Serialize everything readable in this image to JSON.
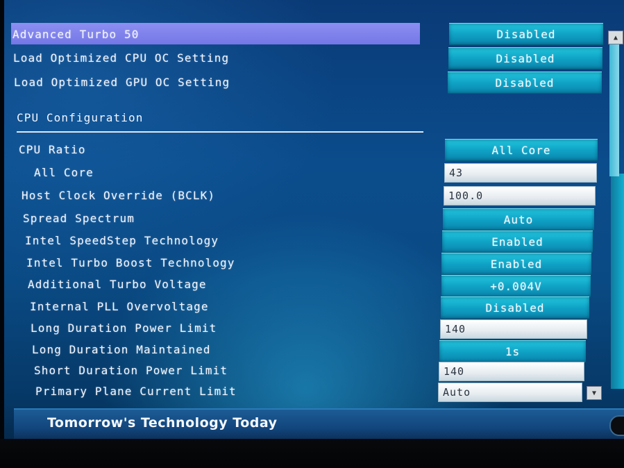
{
  "settings_top": [
    {
      "label": "Advanced Turbo 50",
      "value": "Disabled",
      "selected": true
    },
    {
      "label": "Load Optimized CPU OC Setting",
      "value": "Disabled"
    },
    {
      "label": "Load Optimized GPU OC Setting",
      "value": "Disabled"
    }
  ],
  "section": {
    "title": "CPU Configuration"
  },
  "cpu_settings": [
    {
      "label": "CPU Ratio",
      "value": "All Core",
      "kind": "button"
    },
    {
      "label": "All Core",
      "value": "43",
      "kind": "field"
    },
    {
      "label": "Host Clock Override (BCLK)",
      "value": "100.0",
      "kind": "field"
    },
    {
      "label": "Spread Spectrum",
      "value": "Auto",
      "kind": "button"
    },
    {
      "label": "Intel SpeedStep Technology",
      "value": "Enabled",
      "kind": "button"
    },
    {
      "label": "Intel Turbo Boost Technology",
      "value": "Enabled",
      "kind": "button"
    },
    {
      "label": "Additional Turbo Voltage",
      "value": "+0.004V",
      "kind": "button"
    },
    {
      "label": "Internal PLL Overvoltage",
      "value": "Disabled",
      "kind": "button"
    },
    {
      "label": "Long Duration Power Limit",
      "value": "140",
      "kind": "field"
    },
    {
      "label": "Long Duration Maintained",
      "value": "1s",
      "kind": "button"
    },
    {
      "label": "Short Duration Power Limit",
      "value": "140",
      "kind": "field"
    },
    {
      "label": "Primary Plane Current Limit",
      "value": "Auto",
      "kind": "field"
    }
  ],
  "footer": {
    "tagline": "Tomorrow's Technology Today"
  },
  "icons": {
    "scroll_up": "scroll-up-arrow-icon",
    "scroll_down": "scroll-down-arrow-icon"
  },
  "colors": {
    "highlight": "#7f81ec",
    "option_button": "#15aed0",
    "background": "#0b4c8c"
  }
}
